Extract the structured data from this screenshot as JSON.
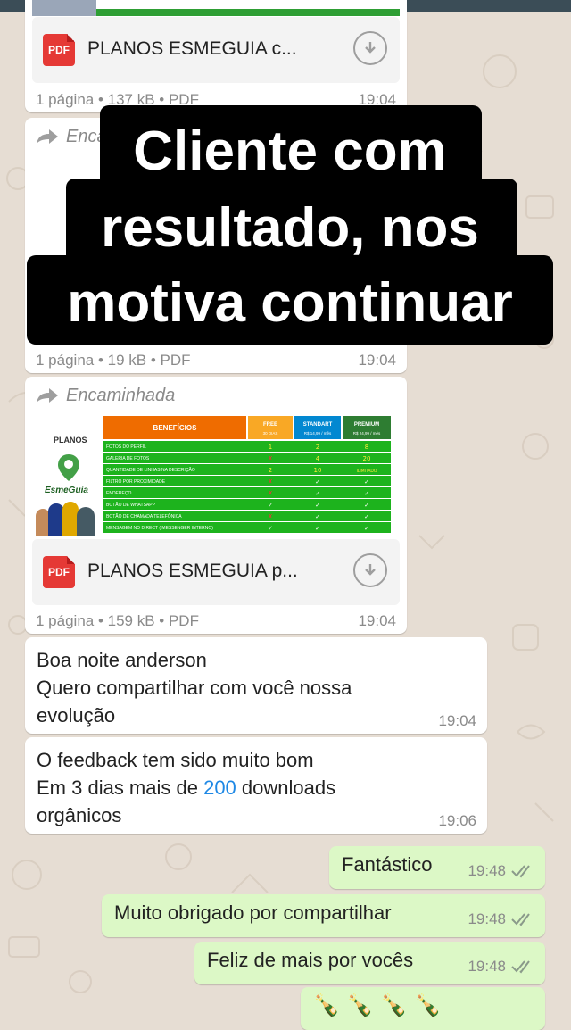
{
  "colors": {
    "wallpaper": "#e6ddd3",
    "incoming": "#ffffff",
    "outgoing": "#dcf8c6",
    "pdf": "#e53935",
    "link": "#1e88e5",
    "tick": "#8a9a8a",
    "overlay_bg": "#000000",
    "overlay_text": "#ffffff"
  },
  "overlay": {
    "line1": "Cliente com",
    "line2": "resultado, nos",
    "line3": "motiva continuar"
  },
  "doc1": {
    "icon": "pdf-icon",
    "pdf_label": "PDF",
    "name": "PLANOS ESMEGUIA c...",
    "meta": "1 página • 137 kB • PDF",
    "time": "19:04"
  },
  "doc2": {
    "forward_label": "Encaminhada",
    "meta": "1 página • 19 kB • PDF",
    "time": "19:04"
  },
  "doc3": {
    "forward_label": "Encaminhada",
    "thumbnail": {
      "planos_label": "PLANOS",
      "brand": "EsmeGuia",
      "headers": [
        "BENEFÍCIOS",
        "FREE",
        "STANDART",
        "PREMIUM"
      ],
      "subheaders": [
        "30 DIAS",
        "R$ 14,99 / mês",
        "R$ 24,99 / mês"
      ],
      "rows": [
        {
          "label": "FOTOS DO PERFIL",
          "free": "1",
          "std": "2",
          "pre": "8"
        },
        {
          "label": "GALERIA DE FOTOS",
          "free": "✗",
          "std": "4",
          "pre": "20"
        },
        {
          "label": "QUANTIDADE DE LINHAS NA DESCRIÇÃO",
          "free": "2",
          "std": "10",
          "pre": "ILIMITADO"
        },
        {
          "label": "FILTRO POR PROXIMIDADE",
          "free": "✗",
          "std": "✓",
          "pre": "✓"
        },
        {
          "label": "ENDEREÇO",
          "free": "✗",
          "std": "✓",
          "pre": "✓"
        },
        {
          "label": "BOTÃO DE WHATSAPP",
          "free": "✓",
          "std": "✓",
          "pre": "✓"
        },
        {
          "label": "BOTÃO DE CHAMADA TELEFÔNICA",
          "free": "✗",
          "std": "✓",
          "pre": "✓"
        },
        {
          "label": "MENSAGEM NO DIRECT ( MESSENGER INTERNO)",
          "free": "✓",
          "std": "✓",
          "pre": "✓"
        }
      ]
    },
    "icon": "pdf-icon",
    "pdf_label": "PDF",
    "name": "PLANOS ESMEGUIA p...",
    "meta": "1 página • 159 kB • PDF",
    "time": "19:04"
  },
  "msg1": {
    "lines": [
      "Boa noite anderson",
      "Quero compartilhar com você nossa",
      "evolução"
    ],
    "time": "19:04"
  },
  "msg2": {
    "line1": "O feedback tem sido muito bom",
    "line2_pre": "Em 3 dias mais de ",
    "line2_num": "200",
    "line2_post": " downloads",
    "line3": "orgânicos",
    "time": "19:06"
  },
  "out": [
    {
      "text": "Fantástico",
      "time": "19:48",
      "status_icon": "double-check-icon"
    },
    {
      "text": "Muito obrigado por compartilhar",
      "time": "19:48",
      "status_icon": "double-check-icon"
    },
    {
      "text": "Feliz de mais por vocês",
      "time": "19:48",
      "status_icon": "double-check-icon"
    },
    {
      "text": "🍾🍾🍾🍾",
      "emoji_icon": "bottle-icon"
    }
  ]
}
